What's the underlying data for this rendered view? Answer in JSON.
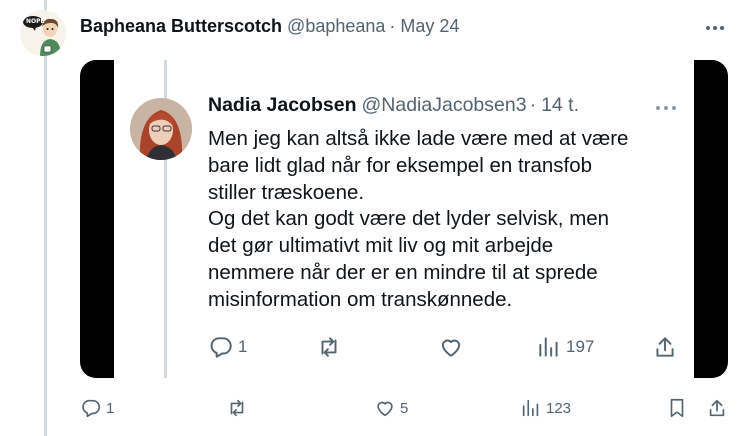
{
  "tweet": {
    "author_name": "Bapheana Butterscotch",
    "author_handle": "@bapheana",
    "separator": "·",
    "date": "May 24",
    "avatar_badge_text": "NOPE",
    "actions": {
      "reply_count": "1",
      "like_count": "5",
      "views_count": "123"
    }
  },
  "quoted_screenshot": {
    "author_name": "Nadia Jacobsen",
    "author_handle": "@NadiaJacobsen3",
    "separator": "·",
    "time": "14 t.",
    "body_lines": [
      "Men jeg kan altså ikke lade være med at være",
      "bare lidt glad når for eksempel en transfob",
      "stiller træskoene.",
      "Og det kan godt være det lyder selvisk, men",
      "det gør ultimativt mit liv og mit arbejde",
      "nemmere når der er en mindre til at sprede",
      "misinformation om transkønnede."
    ],
    "actions": {
      "reply_count": "1",
      "views_count": "197"
    }
  },
  "colors": {
    "text_primary": "#0f1419",
    "text_secondary": "#536471",
    "thread_line": "#cfd9de",
    "media_background": "#000000"
  }
}
